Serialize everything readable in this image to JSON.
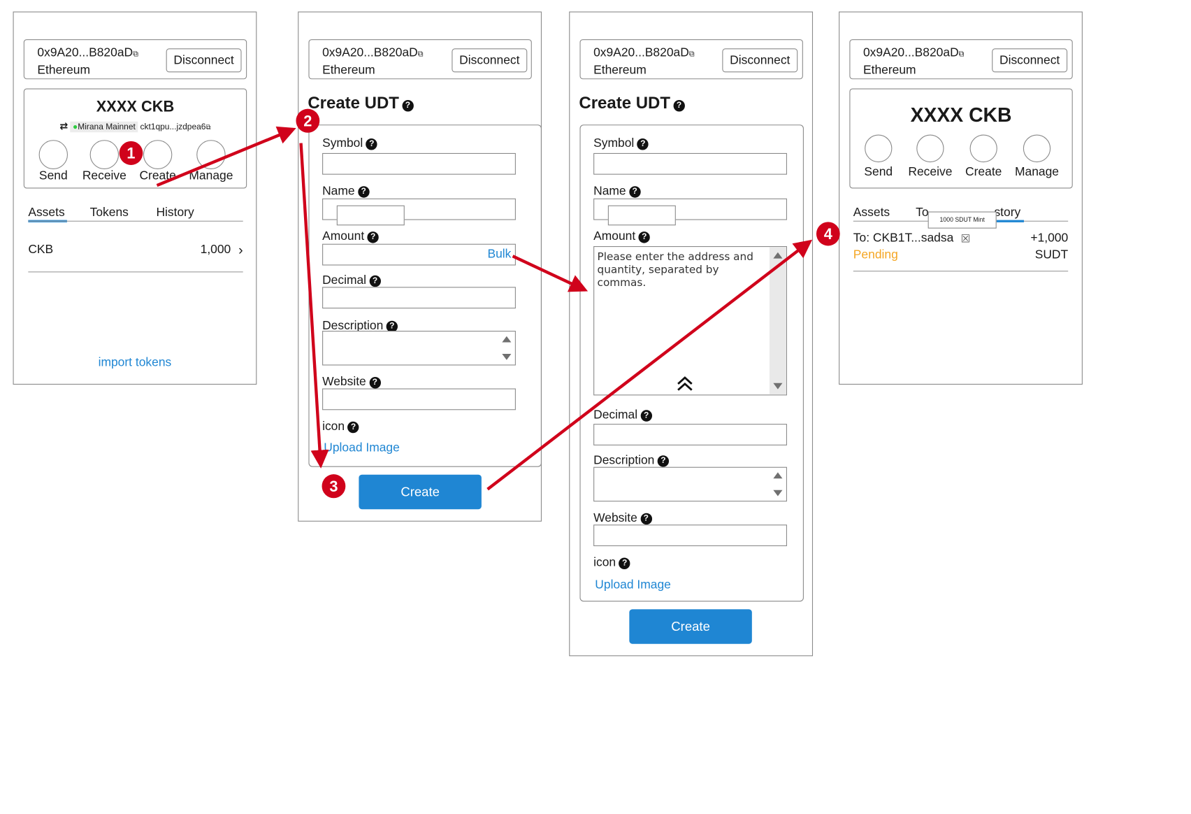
{
  "header": {
    "address": "0x9A20...B820aD",
    "chain": "Ethereum",
    "disconnect": "Disconnect"
  },
  "screen1": {
    "balance": "XXXX CKB",
    "network_prefix": "⇄",
    "network": "Mirana Mainnet",
    "ckb_address": "ckt1qpu...jzdpea6",
    "actions": [
      "Send",
      "Receive",
      "Create",
      "Manage"
    ],
    "tabs": [
      "Assets",
      "Tokens",
      "History"
    ],
    "asset_name": "CKB",
    "asset_amount": "1,000",
    "import_link": "import tokens"
  },
  "form": {
    "title": "Create UDT",
    "symbol": "Symbol",
    "name": "Name",
    "amount": "Amount",
    "bulk": "Bulk",
    "decimal": "Decimal",
    "description": "Description",
    "website": "Website",
    "icon": "icon",
    "upload": "Upload Image",
    "create": "Create",
    "bulk_placeholder": "Please enter the address and quantity, separated by commas."
  },
  "screen4": {
    "balance": "XXXX CKB",
    "actions": [
      "Send",
      "Receive",
      "Create",
      "Manage"
    ],
    "tabs": [
      "Assets",
      "To",
      "story"
    ],
    "tooltip": "1000 SDUT Mint",
    "tx_to": "To: CKB1T...sadsa",
    "tx_amount": "+1,000",
    "tx_status": "Pending",
    "tx_token": "SUDT"
  },
  "steps": [
    "1",
    "2",
    "3",
    "4"
  ],
  "colors": {
    "accent": "#1f86d3",
    "arrow": "#d0021b",
    "pending": "#f5a623",
    "border": "#8a8a8a"
  }
}
